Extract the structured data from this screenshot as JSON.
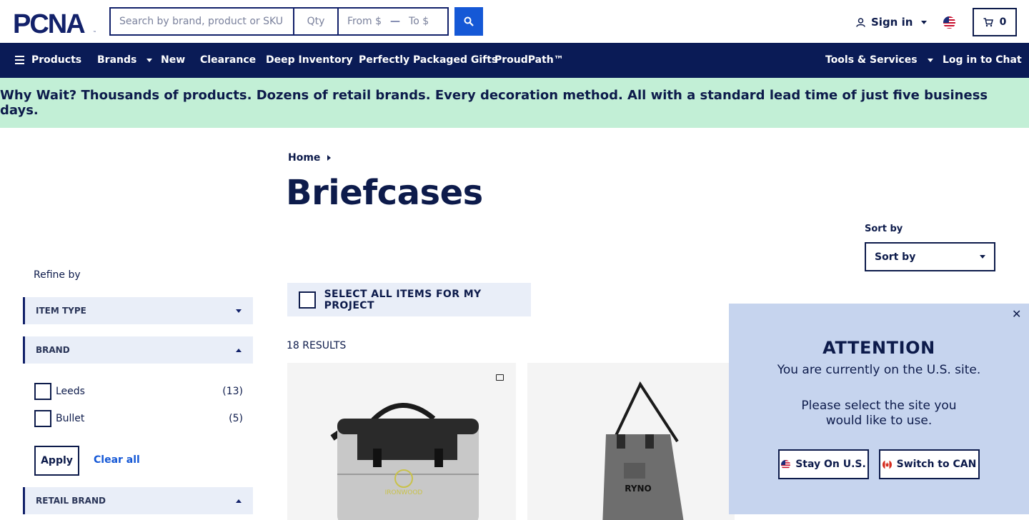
{
  "header": {
    "logo_text": "PCNA",
    "search_placeholder": "Search by brand, product or SKU",
    "qty_placeholder": "Qty",
    "from_placeholder": "From $",
    "to_placeholder": "To $",
    "signin_label": "Sign in",
    "cart_count": "0"
  },
  "nav": {
    "products": "Products",
    "brands": "Brands",
    "new": "New",
    "clearance": "Clearance",
    "deep_inventory": "Deep Inventory",
    "gifts": "Perfectly Packaged Gifts",
    "proudpath": "ProudPath™",
    "tools": "Tools & Services",
    "chat": "Log in to Chat"
  },
  "promo": {
    "text": "Why Wait? Thousands of products. Dozens of retail brands. Every decoration method. All with a standard lead time of just five business days."
  },
  "breadcrumb": {
    "home": "Home"
  },
  "page_title": "Briefcases",
  "sort": {
    "label": "Sort by",
    "selected": "Sort by"
  },
  "sidebar": {
    "refine_label": "Refine by",
    "facets": [
      {
        "label": "ITEM TYPE"
      },
      {
        "label": "BRAND"
      },
      {
        "label": "RETAIL BRAND"
      }
    ],
    "brand_options": [
      {
        "label": "Leeds",
        "count": "(13)"
      },
      {
        "label": "Bullet",
        "count": "(5)"
      }
    ],
    "apply_label": "Apply",
    "clear_label": "Clear all"
  },
  "listing": {
    "select_all_label": "SELECT ALL ITEMS FOR MY PROJECT",
    "results_label": "18 RESULTS",
    "products": [
      {
        "image": "briefcase-grey-black",
        "imprint": "IRONWOOD"
      },
      {
        "image": "messenger-grey",
        "imprint": "RYNO"
      }
    ]
  },
  "modal": {
    "title": "ATTENTION",
    "line1": "You are currently on the U.S. site.",
    "line2": "Please select the site you",
    "line3": "would like to use.",
    "stay_label": "Stay On U.S.",
    "switch_label": "Switch to CAN"
  },
  "colors": {
    "navy": "#0a1b56",
    "link_blue": "#1558d6",
    "promo_green": "#c2efd6",
    "modal_bg": "#c6d4ee",
    "facet_bg": "#e9eef8"
  }
}
